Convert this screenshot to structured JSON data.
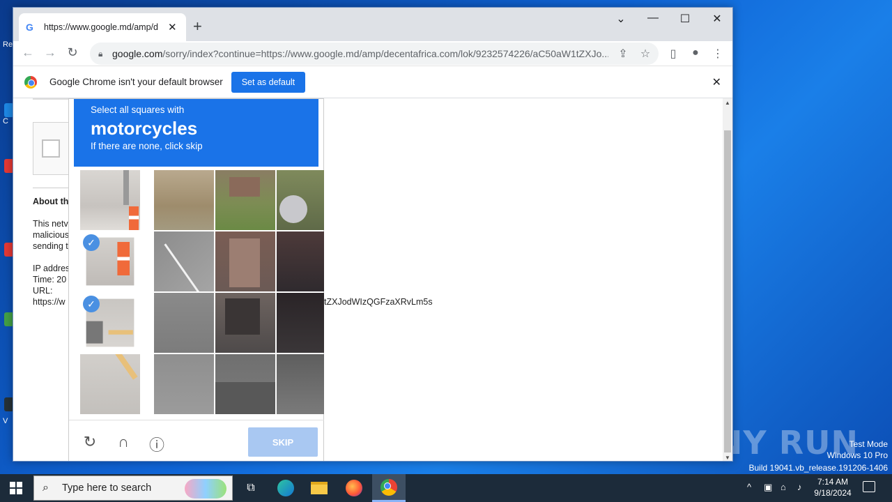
{
  "desktop": {
    "labels": [
      "Re",
      "C",
      "V"
    ],
    "watermark": "ANY RUN",
    "sysinfo": [
      "Test Mode",
      "Windows 10 Pro",
      "Build 19041.vb_release.191206-1406"
    ]
  },
  "browser": {
    "tab_title": "https://www.google.md/amp/d",
    "tab_favicon": "G",
    "window_controls": [
      "⌄",
      "—",
      "☐",
      "✕"
    ],
    "url_host": "google.com",
    "url_path": "/sorry/index?continue=https://www.google.md/amp/decentafrica.com/lok/9232574226/aC50aW1tZXJo...",
    "infobar_text": "Google Chrome isn't your default browser",
    "infobar_button": "Set as default"
  },
  "page": {
    "heading": "About th",
    "lines": [
      "This netv",
      "malicious",
      "sending t"
    ],
    "meta": [
      "IP addres",
      "Time: 20",
      "URL:",
      "https://w"
    ],
    "url_tail": "tZXJodWIzQGFzaXRvLm5s"
  },
  "captcha": {
    "instruction": "Select all squares with",
    "target": "motorcycles",
    "hint": "If there are none, click skip",
    "skip_label": "SKIP",
    "reload_icon": "↻",
    "audio_icon": "∩",
    "info_icon": "ⓘ",
    "check_mark": "✓"
  },
  "taskbar": {
    "search_placeholder": "Type here to search",
    "time": "7:14 AM",
    "date": "9/18/2024",
    "tray_icons": [
      "^",
      "▣",
      "⌂",
      "♪"
    ]
  }
}
